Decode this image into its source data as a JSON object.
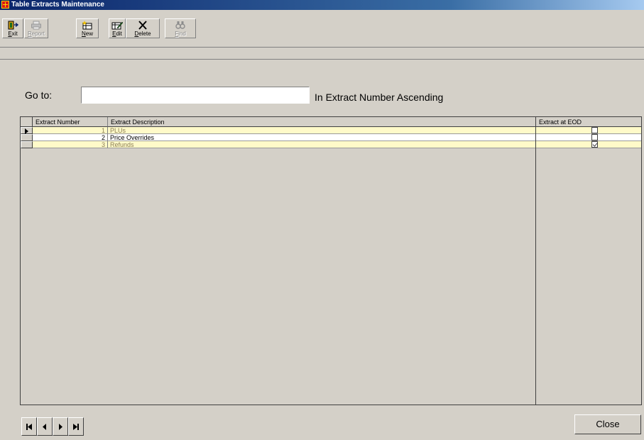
{
  "window": {
    "title": "Table Extracts Maintenance"
  },
  "toolbar": {
    "exit_label": "Exit",
    "report_label": "Report",
    "new_label": "New",
    "edit_label": "Edit",
    "delete_label": "Delete",
    "find_label": "Find"
  },
  "goto": {
    "label": "Go to:",
    "value": "",
    "order_text": "In Extract Number Ascending"
  },
  "grid": {
    "columns": [
      "Extract Number",
      "Extract Description",
      "Extract at EOD"
    ],
    "rows": [
      {
        "number": "1",
        "description": "PLUs",
        "eod": false,
        "current": true
      },
      {
        "number": "2",
        "description": "Price Overrides",
        "eod": false,
        "current": false
      },
      {
        "number": "3",
        "description": "Refunds",
        "eod": true,
        "current": false
      }
    ]
  },
  "navigator": {
    "first": "first-record-icon",
    "prev": "previous-record-icon",
    "next": "next-record-icon",
    "last": "last-record-icon"
  },
  "footer": {
    "close_label": "Close"
  },
  "colors": {
    "titlebar_start": "#0a246a",
    "window_face": "#d4d0c8",
    "row_highlight": "#fffac9"
  }
}
